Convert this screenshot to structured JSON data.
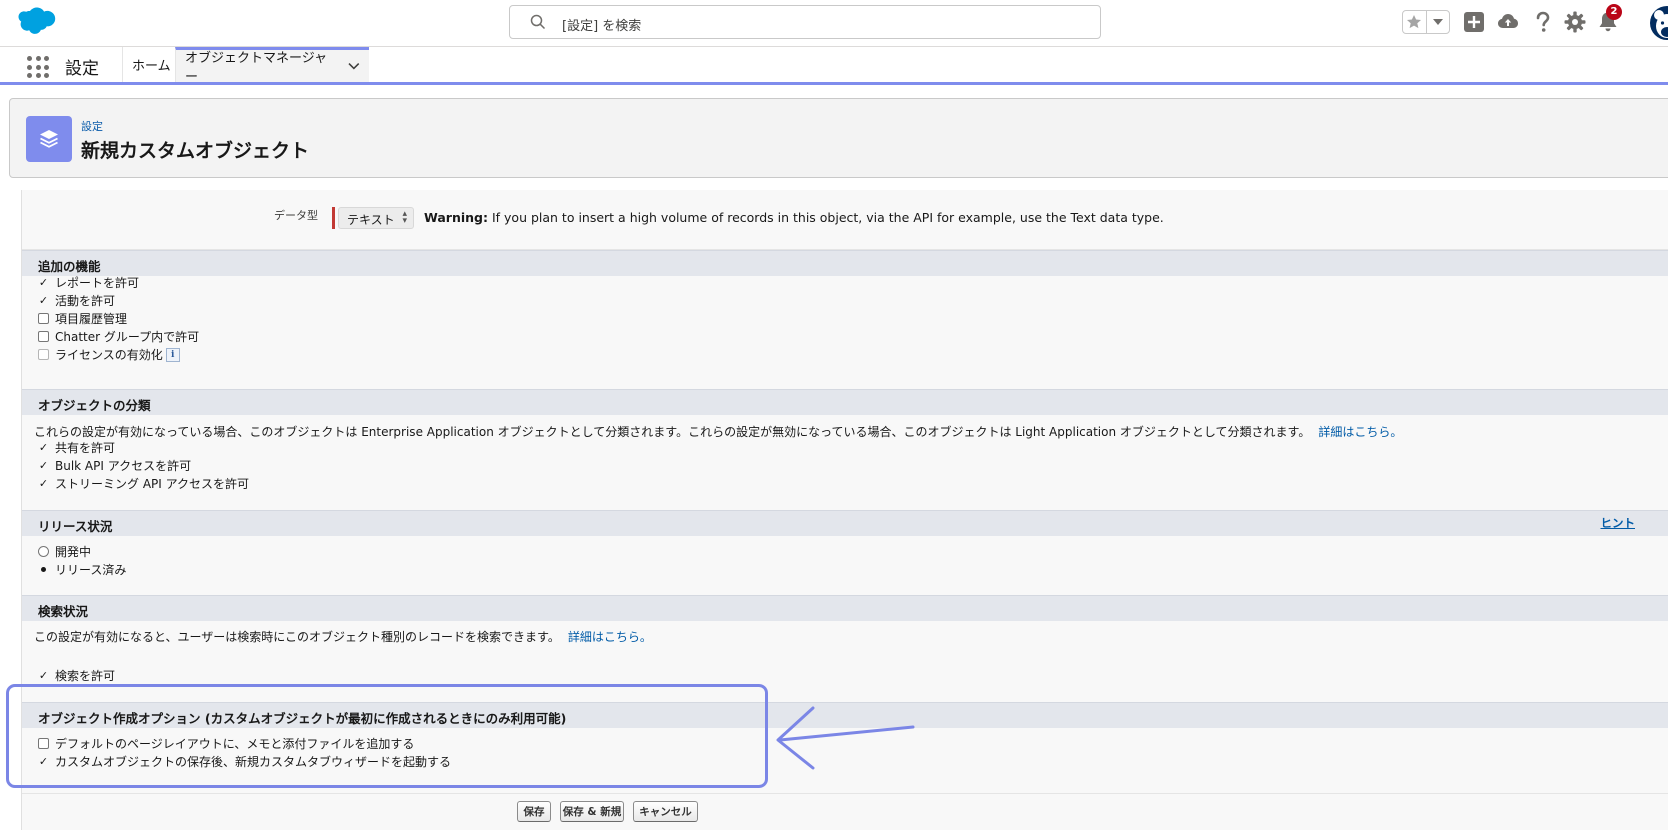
{
  "header": {
    "search_placeholder": "[設定] を検索",
    "notification_count": "2"
  },
  "nav": {
    "app_name": "設定",
    "tabs": [
      {
        "label": "ホーム"
      },
      {
        "label": "オブジェクトマネージャー"
      }
    ]
  },
  "page": {
    "eyebrow": "設定",
    "title": "新規カスタムオブジェクト"
  },
  "data_type": {
    "label": "データ型",
    "value": "テキスト",
    "warning_bold": "Warning:",
    "warning_text": " If you plan to insert a high volume of records in this object, via the API for example, use the Text data type."
  },
  "sections": {
    "features": {
      "title": "追加の機能",
      "items": [
        {
          "label": "レポートを許可",
          "checked": true
        },
        {
          "label": "活動を許可",
          "checked": true
        },
        {
          "label": "項目履歴管理",
          "checked": false
        },
        {
          "label": "Chatter グループ内で許可",
          "checked": false
        },
        {
          "label": "ライセンスの有効化",
          "checked": false,
          "disabled": true
        }
      ]
    },
    "classification": {
      "title": "オブジェクトの分類",
      "description": "これらの設定が有効になっている場合、このオブジェクトは Enterprise Application オブジェクトとして分類されます。これらの設定が無効になっている場合、このオブジェクトは Light Application オブジェクトとして分類されます。",
      "link": "詳細はこちら。",
      "items": [
        {
          "label": "共有を許可",
          "checked": true
        },
        {
          "label": "Bulk API アクセスを許可",
          "checked": true
        },
        {
          "label": "ストリーミング API アクセスを許可",
          "checked": true
        }
      ]
    },
    "deployment": {
      "title": "リリース状況",
      "hint": "ヒント",
      "options": [
        {
          "label": "開発中",
          "selected": false
        },
        {
          "label": "リリース済み",
          "selected": true
        }
      ]
    },
    "search": {
      "title": "検索状況",
      "description": "この設定が有効になると、ユーザーは検索時にこのオブジェクト種別のレコードを検索できます。",
      "link": "詳細はこちら。",
      "items": [
        {
          "label": "検索を許可",
          "checked": true
        }
      ]
    },
    "creation": {
      "title": "オブジェクト作成オプション (カスタムオブジェクトが最初に作成されるときにのみ利用可能)",
      "items": [
        {
          "label": "デフォルトのページレイアウトに、メモと添付ファイルを追加する",
          "checked": false
        },
        {
          "label": "カスタムオブジェクトの保存後、新規カスタムタブウィザードを起動する",
          "checked": true
        }
      ]
    }
  },
  "buttons": {
    "save": "保存",
    "save_new": "保存 & 新規",
    "cancel": "キャンセル"
  },
  "colors": {
    "brand": "#00a1e0",
    "accent": "#7f8ced",
    "annotation": "#7b86e6",
    "required": "#c23934"
  }
}
